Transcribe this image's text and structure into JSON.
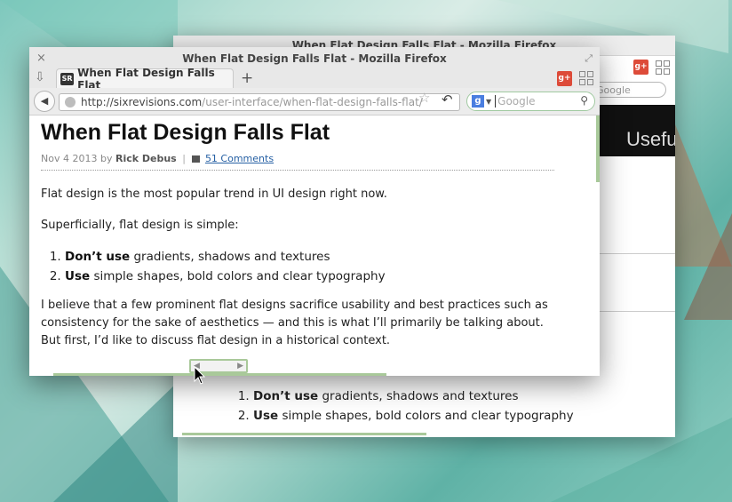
{
  "back_window": {
    "title": "When Flat Design Falls Flat - Mozilla Firefox",
    "search_placeholder": "Google",
    "banner_text": "Usefu",
    "list": [
      {
        "bold": "Don’t use",
        "text": " gradients, shadows and textures"
      },
      {
        "bold": "Use",
        "text": " simple shapes, bold colors and clear typography"
      }
    ]
  },
  "window": {
    "title": "When Flat Design Falls Flat - Mozilla Firefox",
    "close_glyph": "×",
    "maximize_glyph": "⤢"
  },
  "tabs": {
    "active": {
      "label": "When Flat Design Falls Flat",
      "favicon": "SR"
    },
    "new_tab_glyph": "+",
    "gplus_label": "g+"
  },
  "navbar": {
    "url_domain": "http://sixrevisions.com",
    "url_path": "/user-interface/when-flat-design-falls-flat/",
    "search_placeholder": "Google",
    "search_engine_glyph": "g"
  },
  "article": {
    "title": "When Flat Design Falls Flat",
    "date": "Nov 4 2013",
    "by": "by",
    "author": "Rick Debus",
    "separator": "|",
    "comments": "51 Comments",
    "p1": "Flat design is the most popular trend in UI design right now.",
    "p2": "Superficially, flat design is simple:",
    "list": [
      {
        "bold": "Don’t use",
        "text": " gradients, shadows and textures"
      },
      {
        "bold": "Use",
        "text": " simple shapes, bold colors and clear typography"
      }
    ],
    "p3": "I believe that a few prominent flat designs sacrifice usability and best practices such as consistency for the sake of aesthetics — and this is what I’ll primarily be talking about. But first, I’d like to discuss flat design in a historical context."
  },
  "colors": {
    "accent_green": "#a9c99a",
    "link_blue": "#2660a4",
    "gplus_red": "#dd4b39"
  }
}
